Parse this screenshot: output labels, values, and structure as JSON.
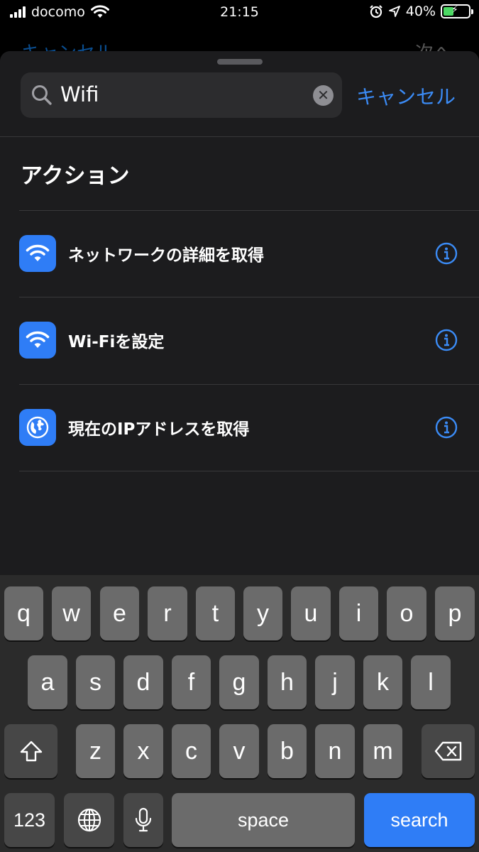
{
  "status_bar": {
    "carrier": "docomo",
    "time": "21:15",
    "battery_percent": "40%",
    "battery_level": 0.4,
    "icons": [
      "signal-icon",
      "wifi-icon",
      "alarm-icon",
      "location-icon",
      "battery-icon"
    ]
  },
  "underlying_nav": {
    "left_label": "キャンセル",
    "right_label": "次へ"
  },
  "search": {
    "value": "Wifi",
    "cancel_label": "キャンセル"
  },
  "section": {
    "title": "アクション"
  },
  "actions": [
    {
      "label": "ネットワークの詳細を取得",
      "icon": "wifi-icon"
    },
    {
      "label": "Wi-Fiを設定",
      "icon": "wifi-icon"
    },
    {
      "label": "現在のIPアドレスを取得",
      "icon": "globe-icon"
    }
  ],
  "colors": {
    "accent": "#3b8bf5",
    "action_icon_bg": "#2f7df6",
    "sheet_bg": "#1c1c1e"
  },
  "keyboard": {
    "row1": [
      "q",
      "w",
      "e",
      "r",
      "t",
      "y",
      "u",
      "i",
      "o",
      "p"
    ],
    "row2": [
      "a",
      "s",
      "d",
      "f",
      "g",
      "h",
      "j",
      "k",
      "l"
    ],
    "row3": [
      "z",
      "x",
      "c",
      "v",
      "b",
      "n",
      "m"
    ],
    "numbers_label": "123",
    "space_label": "space",
    "search_label": "search"
  }
}
